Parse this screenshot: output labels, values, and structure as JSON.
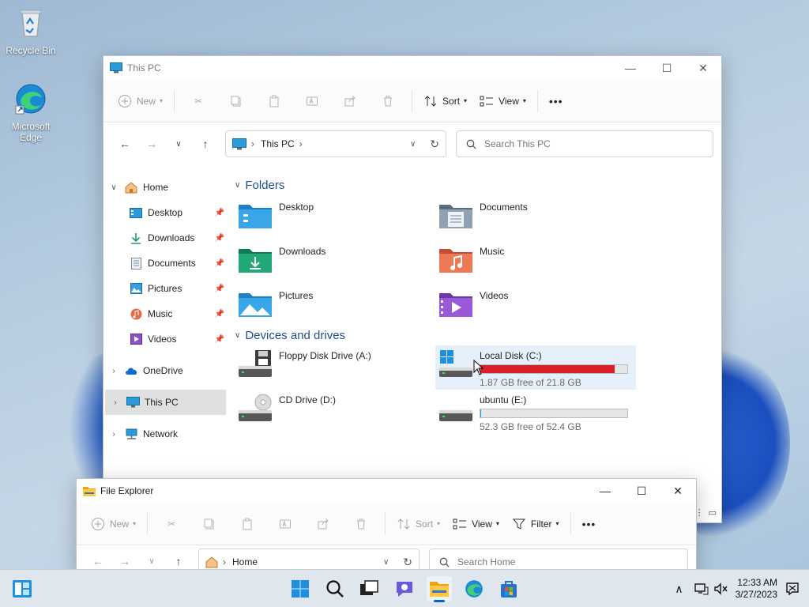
{
  "desktop": {
    "icons": [
      {
        "label": "Recycle Bin",
        "icon": "recycle-bin-icon"
      },
      {
        "label": "Microsoft Edge",
        "icon": "edge-icon"
      }
    ]
  },
  "main_window": {
    "title": "This PC",
    "toolbar": {
      "new_label": "New",
      "sort_label": "Sort",
      "view_label": "View",
      "more_label": "•••"
    },
    "address": "This PC",
    "search_placeholder": "Search This PC",
    "sidebar": [
      {
        "label": "Home",
        "icon": "home-icon"
      },
      {
        "label": "Desktop",
        "icon": "desktop-icon"
      },
      {
        "label": "Downloads",
        "icon": "download-icon"
      },
      {
        "label": "Documents",
        "icon": "document-icon"
      },
      {
        "label": "Pictures",
        "icon": "picture-icon"
      },
      {
        "label": "Music",
        "icon": "music-icon"
      },
      {
        "label": "Videos",
        "icon": "video-icon"
      },
      {
        "label": "OneDrive",
        "icon": "cloud-icon"
      },
      {
        "label": "This PC",
        "icon": "computer-icon"
      },
      {
        "label": "Network",
        "icon": "network-icon"
      }
    ],
    "sections": {
      "folders_header": "Folders",
      "folders": [
        {
          "label": "Desktop",
          "icon": "desktop-folder-icon"
        },
        {
          "label": "Documents",
          "icon": "documents-folder-icon"
        },
        {
          "label": "Downloads",
          "icon": "downloads-folder-icon"
        },
        {
          "label": "Music",
          "icon": "music-folder-icon"
        },
        {
          "label": "Pictures",
          "icon": "pictures-folder-icon"
        },
        {
          "label": "Videos",
          "icon": "videos-folder-icon"
        }
      ],
      "drives_header": "Devices and drives",
      "drives": [
        {
          "label": "Floppy Disk Drive (A:)",
          "icon": "floppy-drive-icon",
          "has_bar": false
        },
        {
          "label": "Local Disk (C:)",
          "icon": "windows-drive-icon",
          "has_bar": true,
          "used_fraction": 0.914,
          "bar_color": "#d9202a",
          "free_text": "1.87 GB free of 21.8 GB"
        },
        {
          "label": "CD Drive (D:)",
          "icon": "cd-drive-icon",
          "has_bar": false
        },
        {
          "label": "ubuntu (E:)",
          "icon": "drive-icon",
          "has_bar": true,
          "used_fraction": 0.002,
          "bar_color": "#26a0da",
          "free_text": "52.3 GB free of 52.4 GB"
        }
      ]
    }
  },
  "second_window": {
    "title": "File Explorer",
    "toolbar": {
      "new_label": "New",
      "sort_label": "Sort",
      "view_label": "View",
      "filter_label": "Filter",
      "more_label": "•••"
    },
    "address": "Home",
    "search_placeholder": "Search Home"
  },
  "taskbar": {
    "time": "12:33 AM",
    "date": "3/27/2023"
  },
  "colors": {
    "accent": "#0067c0",
    "drive_full": "#d9202a",
    "drive_normal": "#26a0da"
  }
}
